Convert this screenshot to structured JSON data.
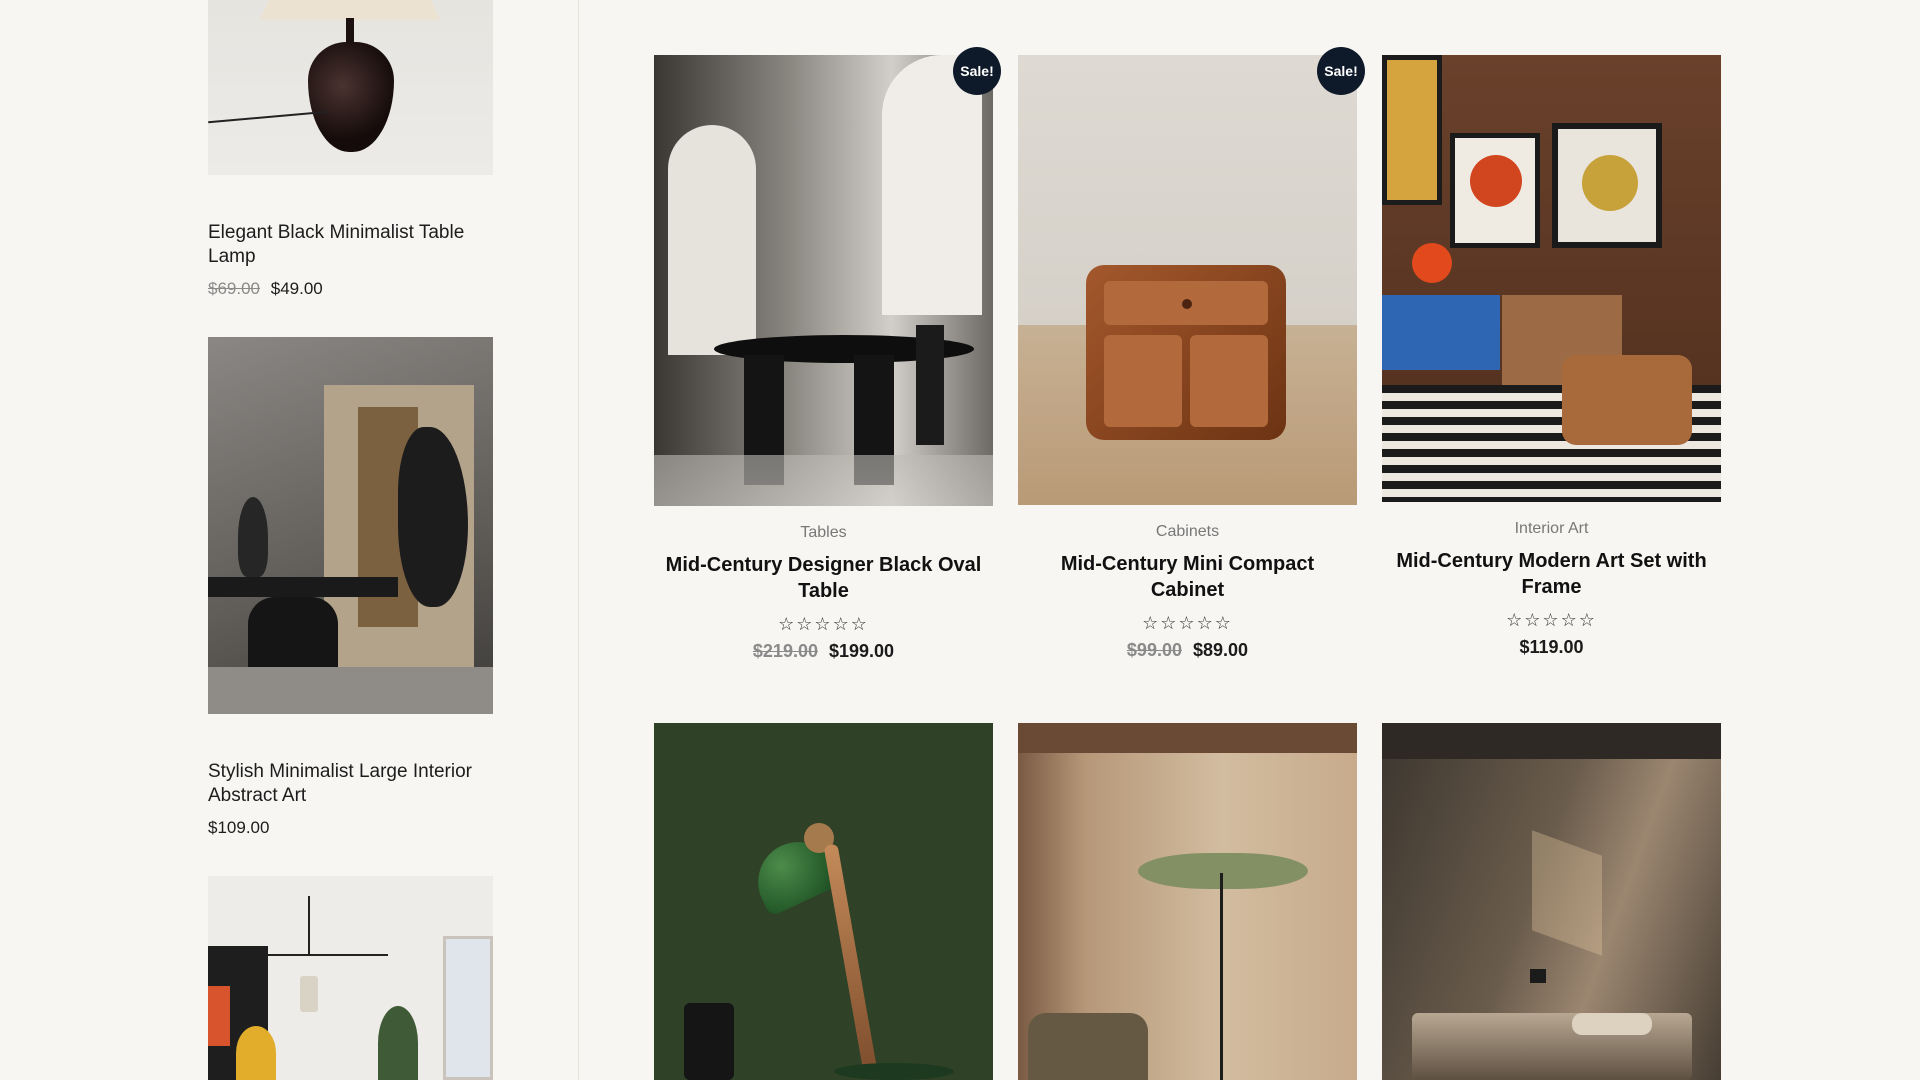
{
  "sidebar": {
    "products": [
      {
        "title": "Elegant Black Minimalist Table Lamp",
        "old_price": "$69.00",
        "price": "$49.00"
      },
      {
        "title": "Stylish Minimalist Large Interior Abstract Art",
        "old_price": "",
        "price": "$109.00"
      }
    ]
  },
  "grid": {
    "products": [
      {
        "badge": "Sale!",
        "category": "Tables",
        "title": "Mid-Century Designer Black Oval Table",
        "rating": "☆☆☆☆☆",
        "old_price": "$219.00",
        "price": "$199.00"
      },
      {
        "badge": "Sale!",
        "category": "Cabinets",
        "title": "Mid-Century Mini Compact Cabinet",
        "rating": "☆☆☆☆☆",
        "old_price": "$99.00",
        "price": "$89.00"
      },
      {
        "badge": "",
        "category": "Interior Art",
        "title": "Mid-Century Modern Art Set with Frame",
        "rating": "☆☆☆☆☆",
        "old_price": "",
        "price": "$119.00"
      }
    ]
  },
  "colors": {
    "background": "#f7f6f3",
    "badge": "#0e1a2a",
    "text": "#111111",
    "muted": "#777777"
  }
}
